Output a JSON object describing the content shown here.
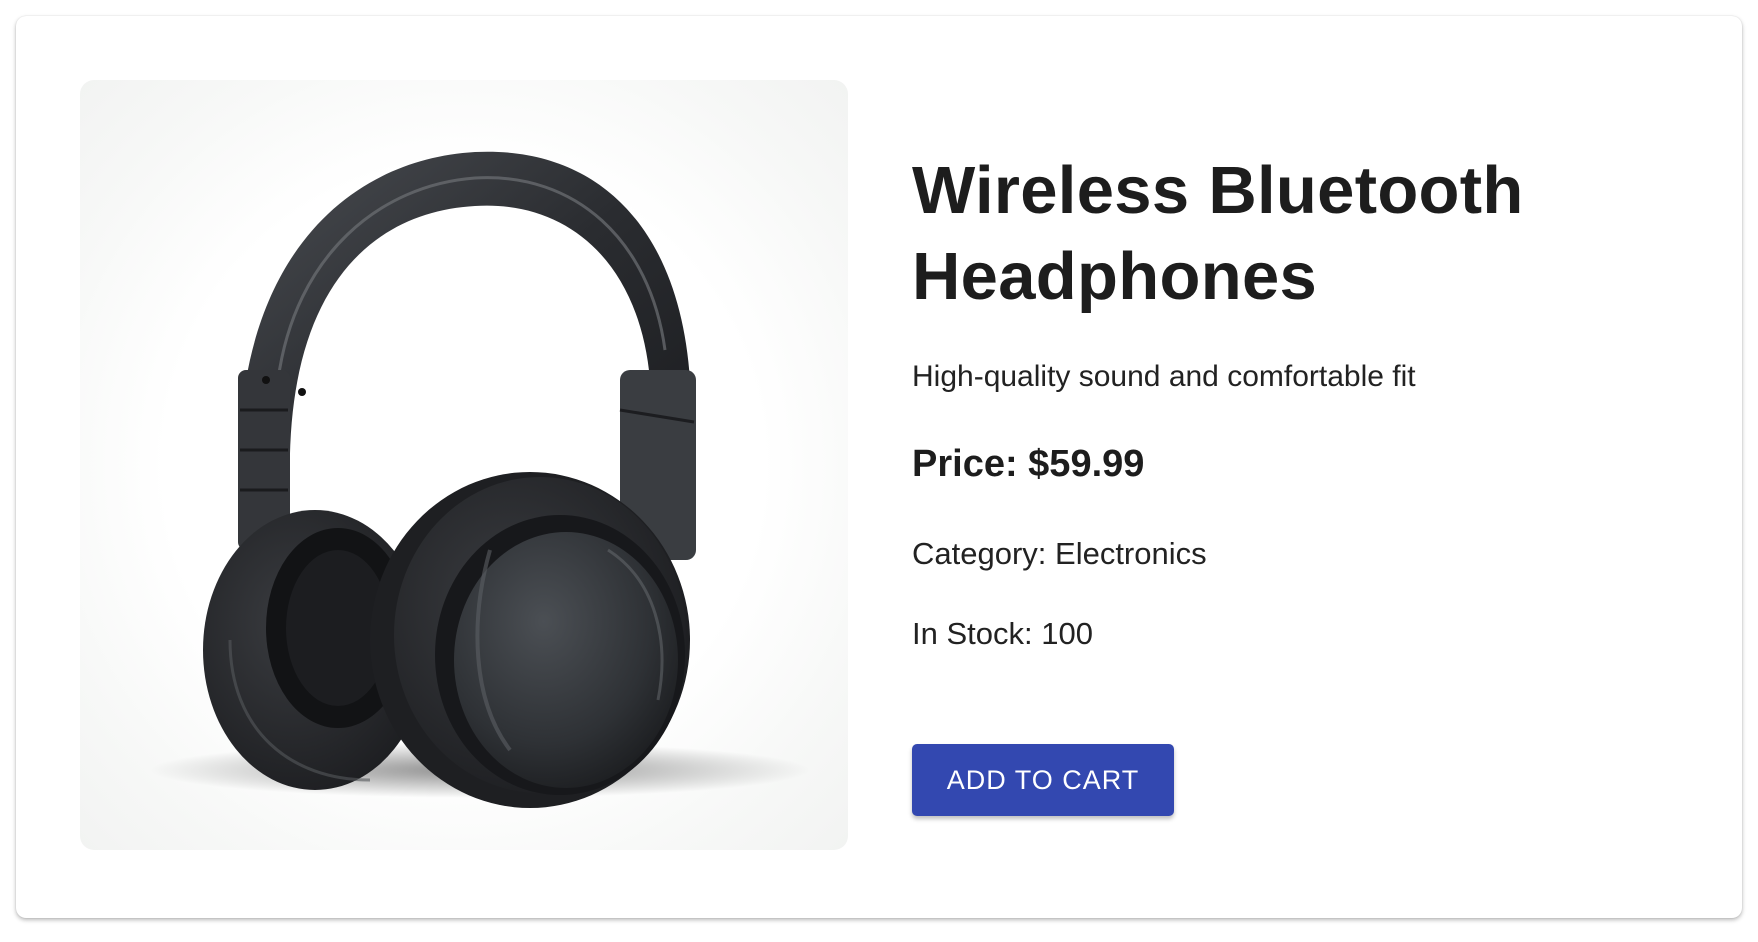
{
  "product": {
    "image_alt": "Wireless Bluetooth Headphones product image",
    "title": "Wireless Bluetooth Headphones",
    "description": "High-quality sound and comfortable fit",
    "price": "Price: $59.99",
    "category": "Category: Electronics",
    "stock": "In Stock: 100",
    "add_to_cart_label": "ADD TO CART"
  },
  "colors": {
    "button": "#3348b0",
    "headphones": "#2b2d30"
  }
}
